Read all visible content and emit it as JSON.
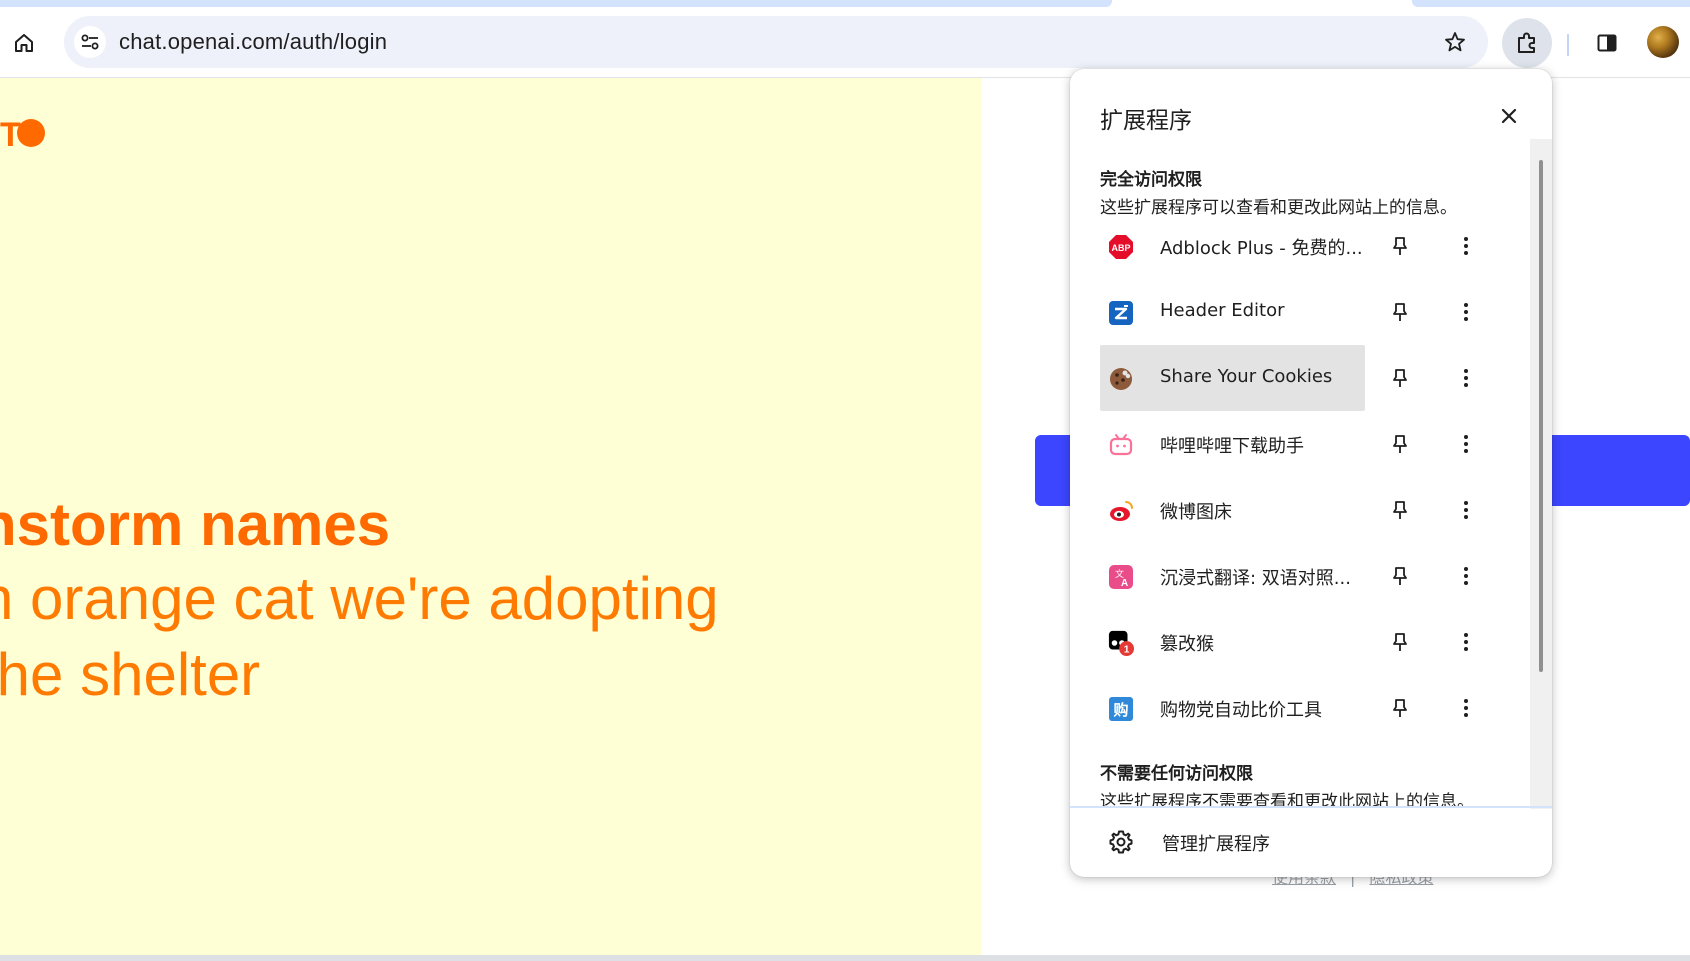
{
  "browser": {
    "url": "chat.openai.com/auth/login"
  },
  "page": {
    "logo_text": "T",
    "hero": {
      "line1": "nstorm names",
      "line2": "n orange cat we're adopting",
      "line3": "  the shelter"
    },
    "footer": {
      "terms": "使用条款",
      "separator": "|",
      "privacy": "隐私政策"
    }
  },
  "extensions_popup": {
    "title": "扩展程序",
    "full_access": {
      "title": "完全访问权限",
      "desc": "这些扩展程序可以查看和更改此网站上的信息。",
      "items": [
        {
          "label": "Adblock Plus - 免费的...",
          "icon": "adblock-plus-icon",
          "color": "#e40e2a"
        },
        {
          "label": "Header Editor",
          "icon": "header-editor-icon",
          "color": "#1565c0"
        },
        {
          "label": "Share Your Cookies",
          "icon": "cookie-icon",
          "color": "#8d5a3b",
          "highlighted": true
        },
        {
          "label": "哔哩哔哩下载助手",
          "icon": "bilibili-icon",
          "color": "#fb7299"
        },
        {
          "label": "微博图床",
          "icon": "weibo-icon",
          "color": "#e6162d"
        },
        {
          "label": "沉浸式翻译: 双语对照...",
          "icon": "translate-icon",
          "color": "#ea4c89"
        },
        {
          "label": "篡改猴",
          "icon": "tampermonkey-icon",
          "color": "#000000",
          "badge": "1"
        },
        {
          "label": "购物党自动比价工具",
          "icon": "gouwudang-icon",
          "color": "#2f89d8"
        }
      ]
    },
    "no_access": {
      "title": "不需要任何访问权限",
      "desc": "这些扩展程序不需要查看和更改此网站上的信息。"
    },
    "manage_label": "管理扩展程序"
  },
  "colors": {
    "accent_orange": "#ff6a00",
    "left_bg": "#ffffd5",
    "cta_blue": "#3c46ff"
  }
}
